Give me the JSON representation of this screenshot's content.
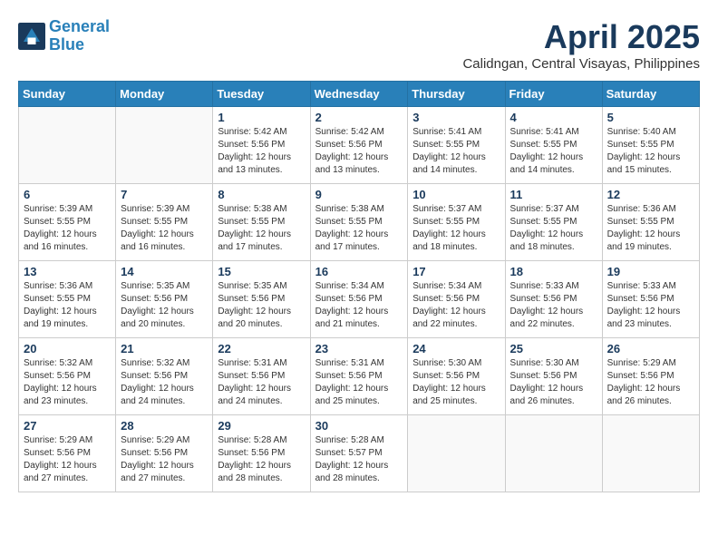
{
  "header": {
    "logo_line1": "General",
    "logo_line2": "Blue",
    "month_title": "April 2025",
    "location": "Calidngan, Central Visayas, Philippines"
  },
  "weekdays": [
    "Sunday",
    "Monday",
    "Tuesday",
    "Wednesday",
    "Thursday",
    "Friday",
    "Saturday"
  ],
  "weeks": [
    [
      {
        "day": "",
        "sunrise": "",
        "sunset": "",
        "daylight": ""
      },
      {
        "day": "",
        "sunrise": "",
        "sunset": "",
        "daylight": ""
      },
      {
        "day": "1",
        "sunrise": "Sunrise: 5:42 AM",
        "sunset": "Sunset: 5:56 PM",
        "daylight": "Daylight: 12 hours and 13 minutes."
      },
      {
        "day": "2",
        "sunrise": "Sunrise: 5:42 AM",
        "sunset": "Sunset: 5:56 PM",
        "daylight": "Daylight: 12 hours and 13 minutes."
      },
      {
        "day": "3",
        "sunrise": "Sunrise: 5:41 AM",
        "sunset": "Sunset: 5:55 PM",
        "daylight": "Daylight: 12 hours and 14 minutes."
      },
      {
        "day": "4",
        "sunrise": "Sunrise: 5:41 AM",
        "sunset": "Sunset: 5:55 PM",
        "daylight": "Daylight: 12 hours and 14 minutes."
      },
      {
        "day": "5",
        "sunrise": "Sunrise: 5:40 AM",
        "sunset": "Sunset: 5:55 PM",
        "daylight": "Daylight: 12 hours and 15 minutes."
      }
    ],
    [
      {
        "day": "6",
        "sunrise": "Sunrise: 5:39 AM",
        "sunset": "Sunset: 5:55 PM",
        "daylight": "Daylight: 12 hours and 16 minutes."
      },
      {
        "day": "7",
        "sunrise": "Sunrise: 5:39 AM",
        "sunset": "Sunset: 5:55 PM",
        "daylight": "Daylight: 12 hours and 16 minutes."
      },
      {
        "day": "8",
        "sunrise": "Sunrise: 5:38 AM",
        "sunset": "Sunset: 5:55 PM",
        "daylight": "Daylight: 12 hours and 17 minutes."
      },
      {
        "day": "9",
        "sunrise": "Sunrise: 5:38 AM",
        "sunset": "Sunset: 5:55 PM",
        "daylight": "Daylight: 12 hours and 17 minutes."
      },
      {
        "day": "10",
        "sunrise": "Sunrise: 5:37 AM",
        "sunset": "Sunset: 5:55 PM",
        "daylight": "Daylight: 12 hours and 18 minutes."
      },
      {
        "day": "11",
        "sunrise": "Sunrise: 5:37 AM",
        "sunset": "Sunset: 5:55 PM",
        "daylight": "Daylight: 12 hours and 18 minutes."
      },
      {
        "day": "12",
        "sunrise": "Sunrise: 5:36 AM",
        "sunset": "Sunset: 5:55 PM",
        "daylight": "Daylight: 12 hours and 19 minutes."
      }
    ],
    [
      {
        "day": "13",
        "sunrise": "Sunrise: 5:36 AM",
        "sunset": "Sunset: 5:55 PM",
        "daylight": "Daylight: 12 hours and 19 minutes."
      },
      {
        "day": "14",
        "sunrise": "Sunrise: 5:35 AM",
        "sunset": "Sunset: 5:56 PM",
        "daylight": "Daylight: 12 hours and 20 minutes."
      },
      {
        "day": "15",
        "sunrise": "Sunrise: 5:35 AM",
        "sunset": "Sunset: 5:56 PM",
        "daylight": "Daylight: 12 hours and 20 minutes."
      },
      {
        "day": "16",
        "sunrise": "Sunrise: 5:34 AM",
        "sunset": "Sunset: 5:56 PM",
        "daylight": "Daylight: 12 hours and 21 minutes."
      },
      {
        "day": "17",
        "sunrise": "Sunrise: 5:34 AM",
        "sunset": "Sunset: 5:56 PM",
        "daylight": "Daylight: 12 hours and 22 minutes."
      },
      {
        "day": "18",
        "sunrise": "Sunrise: 5:33 AM",
        "sunset": "Sunset: 5:56 PM",
        "daylight": "Daylight: 12 hours and 22 minutes."
      },
      {
        "day": "19",
        "sunrise": "Sunrise: 5:33 AM",
        "sunset": "Sunset: 5:56 PM",
        "daylight": "Daylight: 12 hours and 23 minutes."
      }
    ],
    [
      {
        "day": "20",
        "sunrise": "Sunrise: 5:32 AM",
        "sunset": "Sunset: 5:56 PM",
        "daylight": "Daylight: 12 hours and 23 minutes."
      },
      {
        "day": "21",
        "sunrise": "Sunrise: 5:32 AM",
        "sunset": "Sunset: 5:56 PM",
        "daylight": "Daylight: 12 hours and 24 minutes."
      },
      {
        "day": "22",
        "sunrise": "Sunrise: 5:31 AM",
        "sunset": "Sunset: 5:56 PM",
        "daylight": "Daylight: 12 hours and 24 minutes."
      },
      {
        "day": "23",
        "sunrise": "Sunrise: 5:31 AM",
        "sunset": "Sunset: 5:56 PM",
        "daylight": "Daylight: 12 hours and 25 minutes."
      },
      {
        "day": "24",
        "sunrise": "Sunrise: 5:30 AM",
        "sunset": "Sunset: 5:56 PM",
        "daylight": "Daylight: 12 hours and 25 minutes."
      },
      {
        "day": "25",
        "sunrise": "Sunrise: 5:30 AM",
        "sunset": "Sunset: 5:56 PM",
        "daylight": "Daylight: 12 hours and 26 minutes."
      },
      {
        "day": "26",
        "sunrise": "Sunrise: 5:29 AM",
        "sunset": "Sunset: 5:56 PM",
        "daylight": "Daylight: 12 hours and 26 minutes."
      }
    ],
    [
      {
        "day": "27",
        "sunrise": "Sunrise: 5:29 AM",
        "sunset": "Sunset: 5:56 PM",
        "daylight": "Daylight: 12 hours and 27 minutes."
      },
      {
        "day": "28",
        "sunrise": "Sunrise: 5:29 AM",
        "sunset": "Sunset: 5:56 PM",
        "daylight": "Daylight: 12 hours and 27 minutes."
      },
      {
        "day": "29",
        "sunrise": "Sunrise: 5:28 AM",
        "sunset": "Sunset: 5:56 PM",
        "daylight": "Daylight: 12 hours and 28 minutes."
      },
      {
        "day": "30",
        "sunrise": "Sunrise: 5:28 AM",
        "sunset": "Sunset: 5:57 PM",
        "daylight": "Daylight: 12 hours and 28 minutes."
      },
      {
        "day": "",
        "sunrise": "",
        "sunset": "",
        "daylight": ""
      },
      {
        "day": "",
        "sunrise": "",
        "sunset": "",
        "daylight": ""
      },
      {
        "day": "",
        "sunrise": "",
        "sunset": "",
        "daylight": ""
      }
    ]
  ]
}
